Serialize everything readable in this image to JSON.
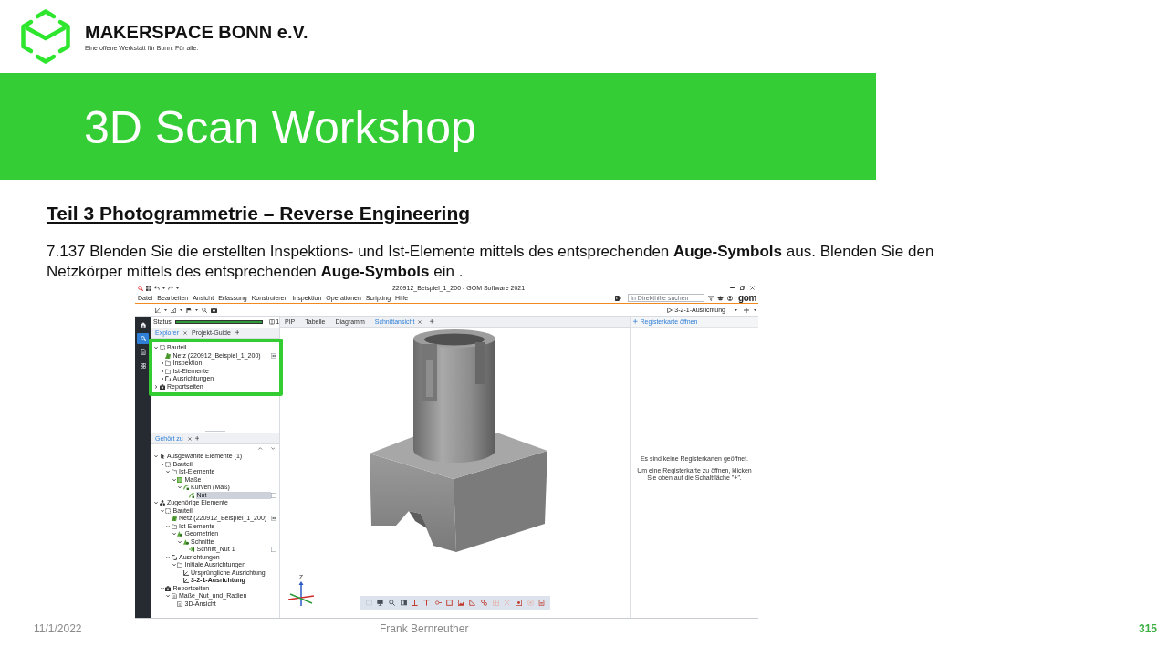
{
  "header": {
    "logo_name": "MAKERSPACE BONN e.V.",
    "logo_tagline": "Eine offene Werkstatt für Bonn. Für alle."
  },
  "banner": {
    "title": "3D Scan Workshop"
  },
  "section": {
    "heading": "Teil 3 Photogrammetrie – Reverse Engineering",
    "instruction": "7.137 Blenden Sie die erstellten Inspektions- und Ist-Elemente mittels des entsprechenden **Auge-Symbols** aus. Blenden Sie den Netzkörper mittels des entsprechenden **Auge-Symbols** ein ."
  },
  "screenshot": {
    "window": {
      "title": "220912_Beispiel_1_200 - GOM Software 2021"
    },
    "menu": [
      "Datei",
      "Bearbeiten",
      "Ansicht",
      "Erfassung",
      "Konstruieren",
      "Inspektion",
      "Operationen",
      "Scripting",
      "Hilfe"
    ],
    "help_search": {
      "placeholder": "In Direkthilfe suchen"
    },
    "brand": "gom",
    "alignment_select": {
      "value": "3-2-1-Ausrichtung"
    },
    "sidebar": {
      "items": [
        {
          "selected": false
        },
        {
          "selected": true
        },
        {
          "selected": false
        },
        {
          "selected": false
        }
      ]
    },
    "status": {
      "label": "Status",
      "level": 1,
      "count": "1"
    },
    "explorer": {
      "tabs": [
        {
          "label": "Explorer",
          "selected": true
        },
        {
          "label": "Projekt-Guide",
          "selected": false
        }
      ],
      "highlighted": true,
      "tree": [
        {
          "label": "Bauteil",
          "kind": "part",
          "expanded": true,
          "selected": false,
          "children": [
            {
              "label": "Netz (220912_Beispiel_1_200)",
              "kind": "mesh",
              "selected": false,
              "visible": true
            },
            {
              "label": "Inspektion",
              "kind": "group",
              "expanded": false,
              "selected": false
            },
            {
              "label": "Ist-Elemente",
              "kind": "group",
              "expanded": false,
              "selected": false
            },
            {
              "label": "Ausrichtungen",
              "kind": "alignments",
              "expanded": false,
              "selected": false
            }
          ]
        },
        {
          "label": "Reportseiten",
          "kind": "reports",
          "expanded": false,
          "selected": false
        }
      ]
    },
    "related": {
      "tabs": [
        {
          "label": "Gehört zu",
          "selected": true
        }
      ],
      "tree": [
        {
          "label": "Ausgewählte Elemente (1)",
          "kind": "selection",
          "expanded": true,
          "selected": false,
          "children": [
            {
              "label": "Bauteil",
              "kind": "part",
              "expanded": true,
              "selected": false,
              "children": [
                {
                  "label": "Ist-Elemente",
                  "kind": "group",
                  "expanded": true,
                  "selected": false,
                  "children": [
                    {
                      "label": "Maße",
                      "kind": "measure",
                      "expanded": true,
                      "selected": false,
                      "children": [
                        {
                          "label": "Kurven (Maß)",
                          "kind": "curve",
                          "expanded": true,
                          "selected": false,
                          "children": [
                            {
                              "label": "Nut",
                              "kind": "curve",
                              "selected": true,
                              "visible": false
                            }
                          ]
                        }
                      ]
                    }
                  ]
                }
              ]
            }
          ]
        },
        {
          "label": "Zugehörige Elemente",
          "kind": "related",
          "expanded": true,
          "selected": false,
          "children": [
            {
              "label": "Bauteil",
              "kind": "part",
              "expanded": true,
              "selected": false,
              "children": [
                {
                  "label": "Netz (220912_Beispiel_1_200)",
                  "kind": "mesh",
                  "selected": false,
                  "visible": true
                },
                {
                  "label": "Ist-Elemente",
                  "kind": "group",
                  "expanded": true,
                  "selected": false,
                  "children": [
                    {
                      "label": "Geometrien",
                      "kind": "geometry",
                      "expanded": true,
                      "selected": false,
                      "children": [
                        {
                          "label": "Schnitte",
                          "kind": "geometry",
                          "expanded": true,
                          "selected": false,
                          "children": [
                            {
                              "label": "Schnitt_Nut 1",
                              "kind": "section",
                              "selected": false,
                              "visible": false
                            }
                          ]
                        }
                      ]
                    }
                  ]
                },
                {
                  "label": "Ausrichtungen",
                  "kind": "alignments",
                  "expanded": true,
                  "selected": false,
                  "children": [
                    {
                      "label": "Initiale Ausrichtungen",
                      "kind": "group",
                      "expanded": true,
                      "selected": false,
                      "children": [
                        {
                          "label": "Ursprüngliche Ausrichtung",
                          "kind": "alignment",
                          "selected": false,
                          "active": false
                        },
                        {
                          "label": "3-2-1-Ausrichtung",
                          "kind": "alignment",
                          "selected": false,
                          "active": true
                        }
                      ]
                    }
                  ]
                }
              ]
            },
            {
              "label": "Reportseiten",
              "kind": "reports",
              "expanded": true,
              "selected": false,
              "children": [
                {
                  "label": "Maße_Nut_und_Radien",
                  "kind": "page",
                  "expanded": true,
                  "selected": false,
                  "children": [
                    {
                      "label": "3D-Ansicht",
                      "kind": "page",
                      "selected": false
                    }
                  ]
                }
              ]
            }
          ]
        }
      ]
    },
    "view": {
      "tabs": [
        {
          "label": "PIP",
          "selected": false
        },
        {
          "label": "Tabelle",
          "selected": false
        },
        {
          "label": "Diagramm",
          "selected": false
        },
        {
          "label": "Schnittansicht",
          "selected": true
        }
      ],
      "axis_label": "Z",
      "tools": [
        {
          "disabled": true
        },
        {
          "disabled": false
        },
        {
          "disabled": false
        },
        {
          "disabled": false
        },
        {
          "disabled": false
        },
        {
          "disabled": false
        },
        {
          "disabled": false
        },
        {
          "disabled": false
        },
        {
          "disabled": false
        },
        {
          "disabled": false
        },
        {
          "disabled": false
        },
        {
          "disabled": true
        },
        {
          "disabled": true
        },
        {
          "disabled": false
        },
        {
          "disabled": true
        },
        {
          "disabled": false
        }
      ]
    },
    "registers": {
      "button": "Registerkarte öffnen",
      "message": "Es sind keine Registerkarten geöffnet.",
      "hint": "Um eine Registerkarte zu öffnen, klicken Sie oben auf die Schaltfläche \"+\"."
    }
  },
  "footer": {
    "date": "11/1/2022",
    "author": "Frank Bernreuther",
    "page": "315"
  }
}
